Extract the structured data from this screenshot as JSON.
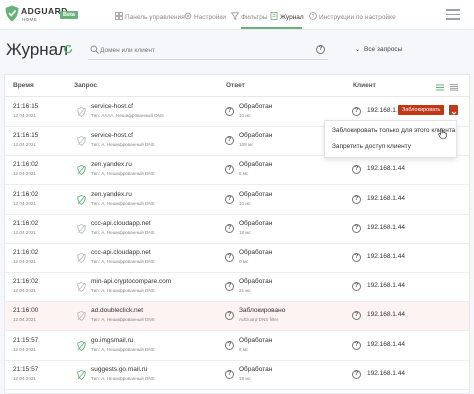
{
  "header": {
    "logo": "ADGUARD",
    "logo_sub": "HOME",
    "badge": "Beta",
    "nav": [
      {
        "label": "Панель управления",
        "icon": "dashboard-icon"
      },
      {
        "label": "Настройки",
        "icon": "gear-icon"
      },
      {
        "label": "Фильтры",
        "icon": "funnel-icon"
      },
      {
        "label": "Журнал",
        "icon": "journal-icon",
        "active": true
      },
      {
        "label": "Инструкции по настройке",
        "icon": "help-circle-icon"
      }
    ]
  },
  "page": {
    "title": "Журнал",
    "search_placeholder": "Домен или клиент",
    "filter_label": "Все запросы"
  },
  "table": {
    "columns": [
      "Время",
      "Запрос",
      "Ответ",
      "Клиент"
    ],
    "rows": [
      {
        "time": "21:16:15",
        "date": "12.04.2021",
        "domain": "service-host.cf",
        "type": "Тип: AAAA, Нешифрованный DNS",
        "status": "Обработан",
        "ms": "10 мс",
        "client": "192.168.1.44",
        "blocked": false,
        "icon": "grey"
      },
      {
        "time": "21:16:15",
        "date": "12.04.2021",
        "domain": "service-host.cf",
        "type": "Тип: A, Нешифрованный DNS",
        "status": "Обработан",
        "ms": "109 мс",
        "client": "192.168.1.44",
        "blocked": false,
        "icon": "grey"
      },
      {
        "time": "21:16:02",
        "date": "12.04.2021",
        "domain": "zen.yandex.ru",
        "type": "Тип: A, Нешифрованный DNS",
        "status": "Обработан",
        "ms": "5 мс",
        "client": "192.168.1.44",
        "blocked": false,
        "icon": "green"
      },
      {
        "time": "21:16:02",
        "date": "12.04.2021",
        "domain": "zen.yandex.ru",
        "type": "Тип: A, Нешифрованный DNS",
        "status": "Обработан",
        "ms": "10 мс",
        "client": "192.168.1.44",
        "blocked": false,
        "icon": "green"
      },
      {
        "time": "21:16:02",
        "date": "12.04.2021",
        "domain": "ccc-api.cloudapp.net",
        "type": "Тип: A, Нешифрованный DNS",
        "status": "Обработан",
        "ms": "18 мс",
        "client": "192.168.1.44",
        "blocked": false,
        "icon": "grey"
      },
      {
        "time": "21:16:02",
        "date": "12.04.2021",
        "domain": "ccc-api.cloudapp.net",
        "type": "Тип: A, Нешифрованный DNS",
        "status": "Обработан",
        "ms": "0 мс",
        "client": "192.168.1.44",
        "blocked": false,
        "icon": "grey"
      },
      {
        "time": "21:16:02",
        "date": "12.04.2021",
        "domain": "min-api.cryptocompare.com",
        "type": "Тип: A, Нешифрованный DNS",
        "status": "Обработан",
        "ms": "31 мс",
        "client": "192.168.1.44",
        "blocked": false,
        "icon": "grey"
      },
      {
        "time": "21:16:00",
        "date": "12.04.2021",
        "domain": "ad.doubleclick.net",
        "type": "Тип: A, Нешифрованный DNS",
        "status": "Заблокировано",
        "ms": "AdGuard DNS filter",
        "client": "192.168.1.44",
        "blocked": true,
        "icon": "grey"
      },
      {
        "time": "21:15:57",
        "date": "12.04.2021",
        "domain": "go.imgsmail.ru",
        "type": "Тип: A, Нешифрованный DNS",
        "status": "Обработан",
        "ms": "8 мс",
        "client": "192.168.1.44",
        "blocked": false,
        "icon": "green"
      },
      {
        "time": "21:15:57",
        "date": "12.04.2021",
        "domain": "suggests.go.mail.ru",
        "type": "Тип: A, Нешифрованный DNS",
        "status": "Обработан",
        "ms": "18 мс",
        "client": "192.168.1.44",
        "blocked": false,
        "icon": "green"
      }
    ]
  },
  "actions": {
    "block_button": "Заблокировать",
    "dropdown": [
      "Заблокировать только для этого клиента",
      "Запретить доступ клиенту"
    ]
  },
  "colors": {
    "accent_green": "#67b279",
    "block_red": "#c23814",
    "blocked_row_bg": "#fdf3f3"
  }
}
